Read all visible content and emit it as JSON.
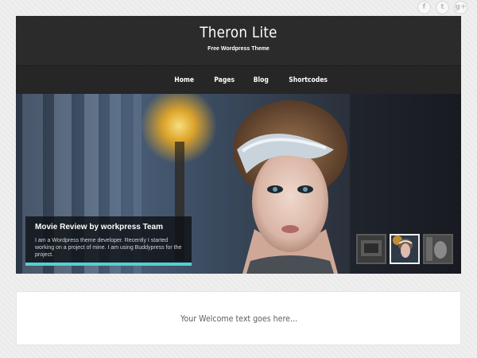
{
  "social": {
    "icons": [
      {
        "name": "facebook-icon",
        "glyph": "f"
      },
      {
        "name": "twitter-icon",
        "glyph": "t"
      },
      {
        "name": "google-plus-icon",
        "glyph": "g+"
      }
    ]
  },
  "header": {
    "title": "Theron Lite",
    "tagline": "Free Wordpress Theme"
  },
  "nav": {
    "items": [
      "Home",
      "Pages",
      "Blog",
      "Shortcodes"
    ]
  },
  "slider": {
    "caption_title": "Movie Review by workpress Team",
    "caption_text": "I am a Wordpress theme developer. Recently I started working on a project of mine. I am using Buddypress for the project.",
    "accent_color": "#54d0d0",
    "active_thumb": 2
  },
  "welcome": {
    "text": "Your Welcome text goes here..."
  }
}
